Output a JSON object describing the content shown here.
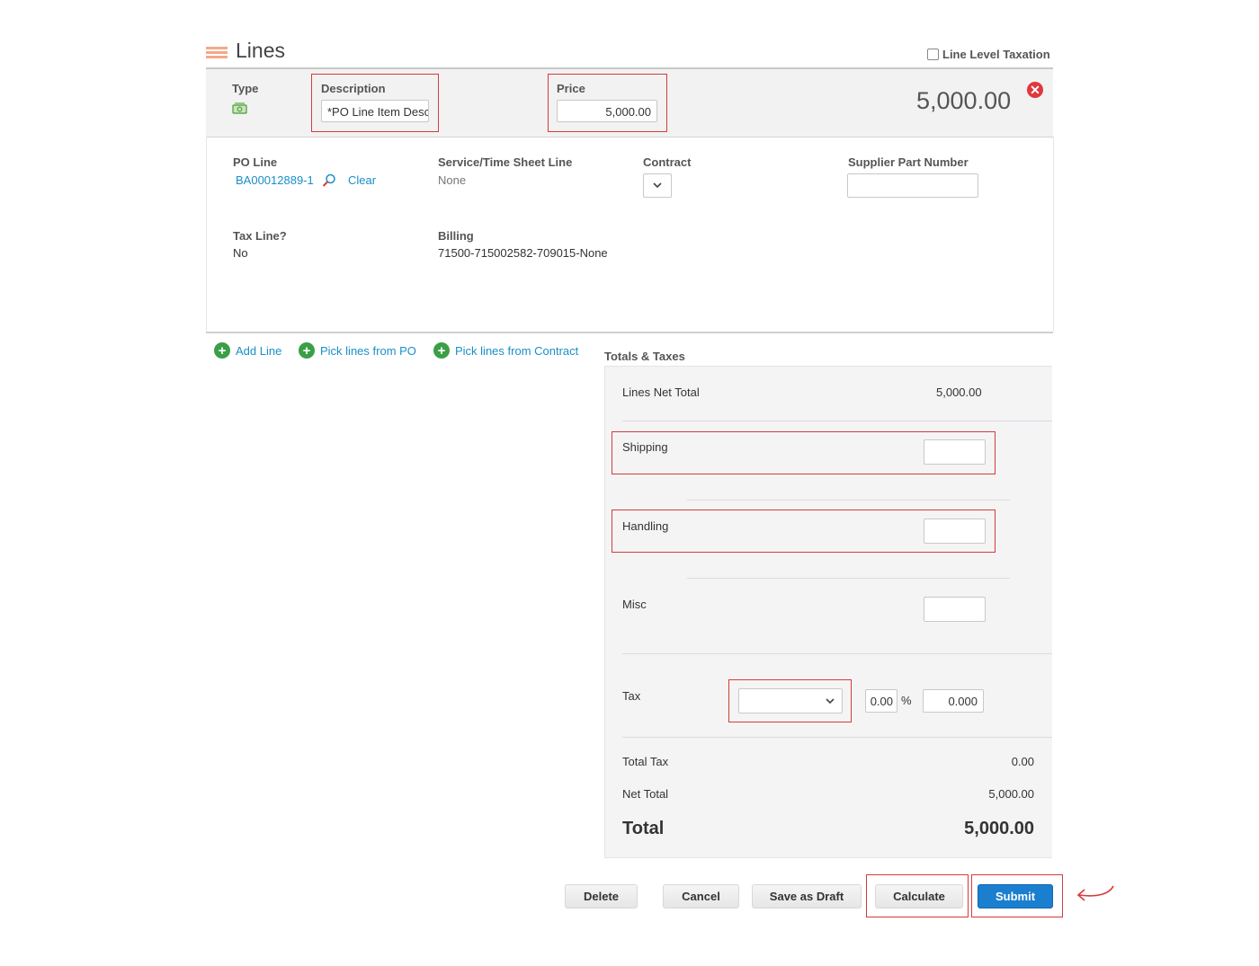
{
  "header": {
    "title": "Lines",
    "line_level_taxation": "Line Level Taxation"
  },
  "line": {
    "type_label": "Type",
    "description_label": "Description",
    "description_value": "*PO Line Item Description",
    "price_label": "Price",
    "price_value": "5,000.00",
    "line_total": "5,000.00",
    "po_line_label": "PO Line",
    "po_line_value": "BA00012889-1",
    "clear_label": "Clear",
    "service_label": "Service/Time Sheet Line",
    "service_value": "None",
    "contract_label": "Contract",
    "supplier_part_label": "Supplier Part Number",
    "supplier_part_value": "",
    "tax_line_label": "Tax Line?",
    "tax_line_value": "No",
    "billing_label": "Billing",
    "billing_value": "71500-715002582-709015-None"
  },
  "actions": {
    "add_line": "Add Line",
    "pick_po": "Pick lines from PO",
    "pick_contract": "Pick lines from Contract"
  },
  "totals": {
    "title": "Totals & Taxes",
    "lines_net_total_label": "Lines Net Total",
    "lines_net_total_value": "5,000.00",
    "shipping_label": "Shipping",
    "shipping_value": "",
    "handling_label": "Handling",
    "handling_value": "",
    "misc_label": "Misc",
    "misc_value": "",
    "tax_label": "Tax",
    "tax_rate": "0.00",
    "percent": "%",
    "tax_amount": "0.000",
    "total_tax_label": "Total Tax",
    "total_tax_value": "0.00",
    "net_total_label": "Net Total",
    "net_total_value": "5,000.00",
    "total_label": "Total",
    "total_value": "5,000.00"
  },
  "buttons": {
    "delete": "Delete",
    "cancel": "Cancel",
    "save_draft": "Save as Draft",
    "calculate": "Calculate",
    "submit": "Submit"
  },
  "colors": {
    "accent": "#1b7fd0",
    "link": "#1a8fc7",
    "highlight": "#d83a3a",
    "add": "#3a9f47"
  }
}
